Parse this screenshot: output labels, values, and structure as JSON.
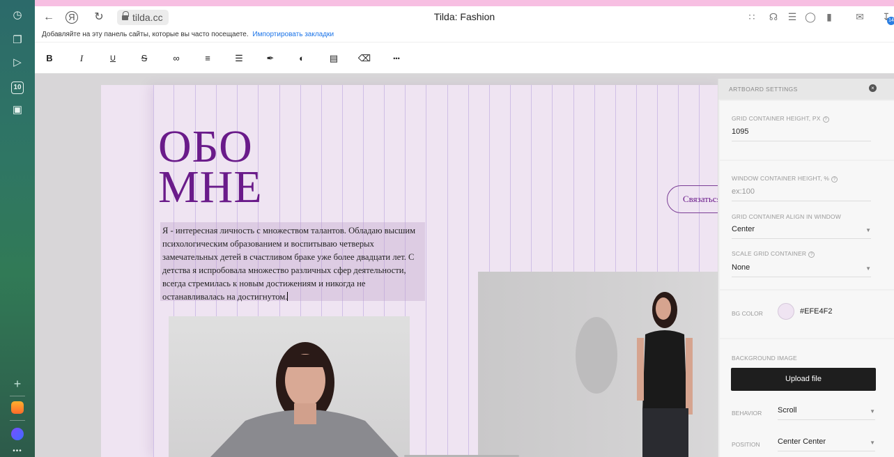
{
  "browser": {
    "page_title": "Tilda: Fashion",
    "url": "tilda.cc",
    "download_badge": "14",
    "bookmarks_prompt": "Добавляйте на эту панель сайты, которые вы часто посещаете.",
    "bookmarks_link": "Импортировать закладки"
  },
  "rail": {
    "tab_counter": "10"
  },
  "toolbar": {
    "bold": "B",
    "italic": "I",
    "underline": "U",
    "strike": "S",
    "more": "•••"
  },
  "artboard": {
    "heading_line1": "ОБО",
    "heading_line2": "МНЕ",
    "bio": "Я - интересная личность с множеством талантов. Обладаю высшим психологическим образованием и воспитываю четверых замечательных детей в счастливом браке уже более двадцати лет. С детства я испробовала множество различных сфер деятельности, всегда стремилась к новым достижениям и никогда не останавливалась на достигнутом.",
    "cta_label": "Связаться",
    "bg_color": "#efe4f2"
  },
  "panel": {
    "title": "ARTBOARD SETTINGS",
    "grid_height_label": "GRID CONTAINER HEIGHT, PX",
    "grid_height_value": "1095",
    "window_height_label": "WINDOW CONTAINER HEIGHT, %",
    "window_height_placeholder": "ex:100",
    "align_label": "GRID CONTAINER ALIGN IN WINDOW",
    "align_value": "Center",
    "scale_label": "SCALE GRID CONTAINER",
    "scale_value": "None",
    "bg_color_label": "BG COLOR",
    "bg_color_value": "#EFE4F2",
    "bg_image_label": "BACKGROUND IMAGE",
    "upload_label": "Upload file",
    "behavior_label": "BEHAVIOR",
    "behavior_value": "Scroll",
    "position_label": "POSITION",
    "position_value": "Center Center"
  }
}
